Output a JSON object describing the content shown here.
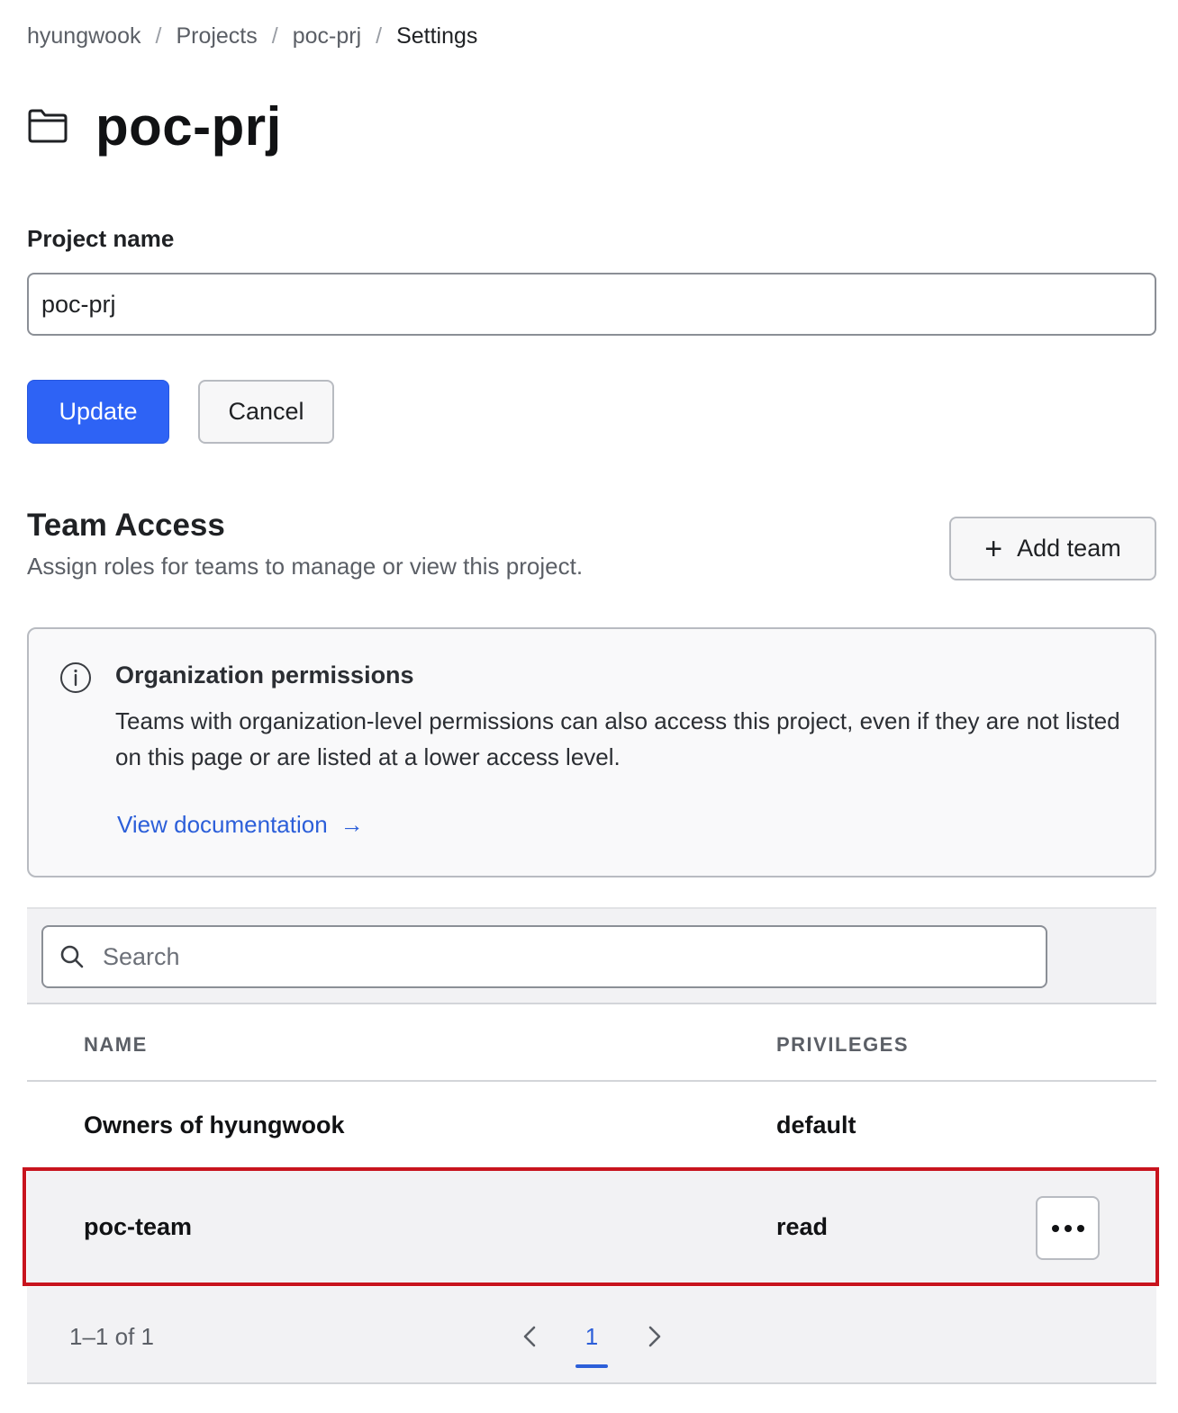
{
  "breadcrumb": {
    "items": [
      "hyungwook",
      "Projects",
      "poc-prj"
    ],
    "current": "Settings",
    "separator": "/"
  },
  "page": {
    "title": "poc-prj",
    "icon": "folder-icon"
  },
  "form": {
    "project_name_label": "Project name",
    "project_name_value": "poc-prj",
    "update_label": "Update",
    "cancel_label": "Cancel"
  },
  "team_access": {
    "title": "Team Access",
    "description": "Assign roles for teams to manage or view this project.",
    "add_team_label": "Add team",
    "add_team_icon": "plus-icon"
  },
  "notice": {
    "icon": "info-icon",
    "title": "Organization permissions",
    "body": "Teams with organization-level permissions can also access this project, even if they are not listed on this page or are listed at a lower access level.",
    "link_label": "View documentation",
    "link_icon": "arrow-right-icon"
  },
  "search": {
    "placeholder": "Search",
    "value": ""
  },
  "table": {
    "columns": [
      "NAME",
      "PRIVILEGES"
    ],
    "rows": [
      {
        "name": "Owners of hyungwook",
        "privileges": "default"
      },
      {
        "name": "poc-team",
        "privileges": "read"
      }
    ]
  },
  "pagination": {
    "range": "1–1 of 1",
    "current_page": "1"
  },
  "colors": {
    "primary": "#2e63f5",
    "link": "#2c5fd9",
    "highlight": "#c8141e"
  }
}
